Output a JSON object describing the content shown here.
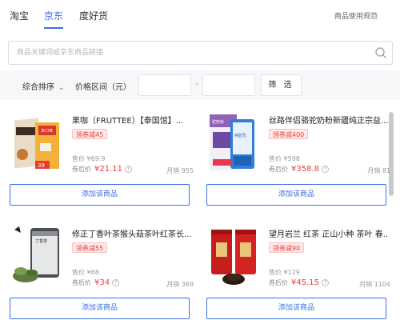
{
  "tabs": [
    {
      "label": "淘宝",
      "active": false
    },
    {
      "label": "京东",
      "active": true
    },
    {
      "label": "度好货",
      "active": false
    }
  ],
  "rules_link": "商品使用规范",
  "search": {
    "placeholder": "商品关键词或京东商品链接",
    "value": ""
  },
  "filters": {
    "sort_label": "综合排序",
    "price_label": "价格区间（元）",
    "price_min": "",
    "price_max": "",
    "separator": "-",
    "filter_button": "筛 选"
  },
  "products": [
    {
      "title": "果咖（FRUTTEE）【泰国馆】...",
      "coupon": "领券减45",
      "orig_price": "售价 ¥69.9",
      "discount_label": "券后价",
      "discount_price": "¥21.11",
      "sales": "月销 955",
      "add_label": "添加该商品",
      "thumb_texts": [
        "多口味",
        "39"
      ]
    },
    {
      "title": "丝路伴侣骆驼奶粉新疆纯正宗益...",
      "coupon": "领券减400",
      "orig_price": "售价 ¥598",
      "discount_label": "券后价",
      "discount_price": "¥358.8",
      "sales": "月销 81",
      "add_label": "添加该商品",
      "thumb_texts": [
        "驼奶粉",
        "纯驼乳"
      ]
    },
    {
      "title": "修正丁香叶茶猴头菇茶叶红茶长...",
      "coupon": "领券减55",
      "orig_price": "售价 ¥68",
      "discount_label": "券后价",
      "discount_price": "¥34",
      "sales": "月销 369",
      "add_label": "添加该商品",
      "thumb_texts": [
        "丁香茶"
      ]
    },
    {
      "title": "望月岩兰 红茶 正山小种 茶叶 春...",
      "coupon": "领券减90",
      "orig_price": "售价 ¥129",
      "discount_label": "券后价",
      "discount_price": "¥45.15",
      "sales": "月销 1104",
      "add_label": "添加该商品",
      "thumb_texts": []
    }
  ],
  "colors": {
    "accent": "#3a6ee8",
    "price": "#e7403d",
    "filter_bg": "#f6f7f9"
  },
  "icons": {
    "search": "search-icon",
    "sort_chevron": "chevron-down-icon",
    "help": "question-icon"
  }
}
